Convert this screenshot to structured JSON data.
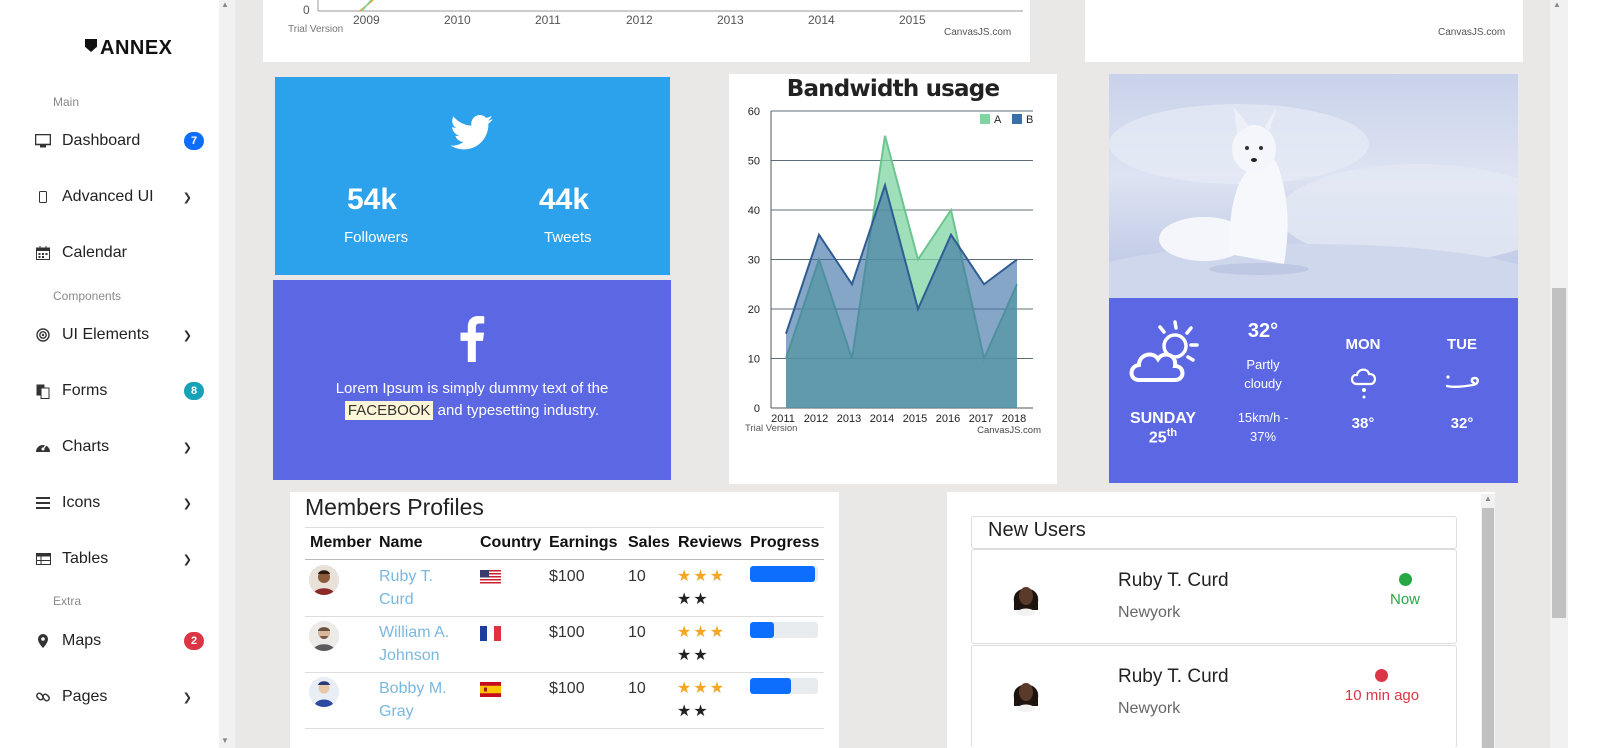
{
  "brand": "ANNEX",
  "sidebar": {
    "sections": [
      {
        "label": "Main"
      },
      {
        "label": "Components"
      },
      {
        "label": "Extra"
      }
    ],
    "items": [
      {
        "label": "Dashboard",
        "badge": "7",
        "badge_color": "#0d6efd"
      },
      {
        "label": "Advanced UI"
      },
      {
        "label": "Calendar"
      },
      {
        "label": "UI Elements"
      },
      {
        "label": "Forms",
        "badge": "8",
        "badge_color": "#17a2b8"
      },
      {
        "label": "Charts"
      },
      {
        "label": "Icons"
      },
      {
        "label": "Tables"
      },
      {
        "label": "Maps",
        "badge": "2",
        "badge_color": "#dc3545"
      },
      {
        "label": "Pages"
      }
    ]
  },
  "top_chart": {
    "y_zero": "0",
    "x_ticks": [
      "2009",
      "2010",
      "2011",
      "2012",
      "2013",
      "2014",
      "2015"
    ],
    "trial": "Trial Version",
    "credit": "CanvasJS.com"
  },
  "top_right_card": {
    "credit": "CanvasJS.com"
  },
  "twitter": {
    "followers_value": "54k",
    "followers_label": "Followers",
    "tweets_value": "44k",
    "tweets_label": "Tweets",
    "color": "#2ba2eb"
  },
  "facebook": {
    "text_before": "Lorem Ipsum is simply dummy text of the",
    "highlight": "FACEBOOK",
    "text_after": "and typesetting industry.",
    "color": "#5b67e3"
  },
  "chart_data": {
    "type": "area",
    "title": "Bandwidth usage",
    "x": [
      "2011",
      "2012",
      "2013",
      "2014",
      "2015",
      "2016",
      "2017",
      "2018"
    ],
    "series": [
      {
        "name": "A",
        "values": [
          10,
          30,
          10,
          55,
          30,
          40,
          10,
          25
        ],
        "color": "#7fd4a2"
      },
      {
        "name": "B",
        "values": [
          15,
          35,
          25,
          45,
          20,
          35,
          25,
          30
        ],
        "color": "#3c6fa6"
      }
    ],
    "ylim": [
      0,
      60
    ],
    "y_ticks": [
      "0",
      "10",
      "20",
      "30",
      "40",
      "50",
      "60"
    ],
    "grid": true,
    "legend": "top-right",
    "trial": "Trial Version",
    "credit": "CanvasJS.com"
  },
  "weather": {
    "day": "SUNDAY",
    "date": "25",
    "date_suffix": "th",
    "temp": "32°",
    "condition": "Partly cloudy",
    "wind": "15km/h - 37%",
    "forecast": [
      {
        "day": "MON",
        "temp": "38°"
      },
      {
        "day": "TUE",
        "temp": "32°"
      }
    ]
  },
  "members": {
    "title": "Members Profiles",
    "columns": [
      "Member",
      "Name",
      "Country",
      "Earnings",
      "Sales",
      "Reviews",
      "Progress"
    ],
    "rows": [
      {
        "name": "Ruby T. Curd",
        "earnings": "$100",
        "sales": "10",
        "country_flag": "us-flag-icon",
        "progress": 0.95
      },
      {
        "name": "William A. Johnson",
        "earnings": "$100",
        "sales": "10",
        "country_flag": "fr-flag-icon",
        "progress": 0.35
      },
      {
        "name": "Bobby M. Gray",
        "earnings": "$100",
        "sales": "10",
        "country_flag": "es-flag-icon",
        "progress": 0.6
      }
    ]
  },
  "new_users": {
    "title": "New Users",
    "users": [
      {
        "name": "Ruby T. Curd",
        "city": "Newyork",
        "status": "Now",
        "status_color": "#28a745"
      },
      {
        "name": "Ruby T. Curd",
        "city": "Newyork",
        "status": "10 min ago",
        "status_color": "#dc3545"
      }
    ]
  }
}
